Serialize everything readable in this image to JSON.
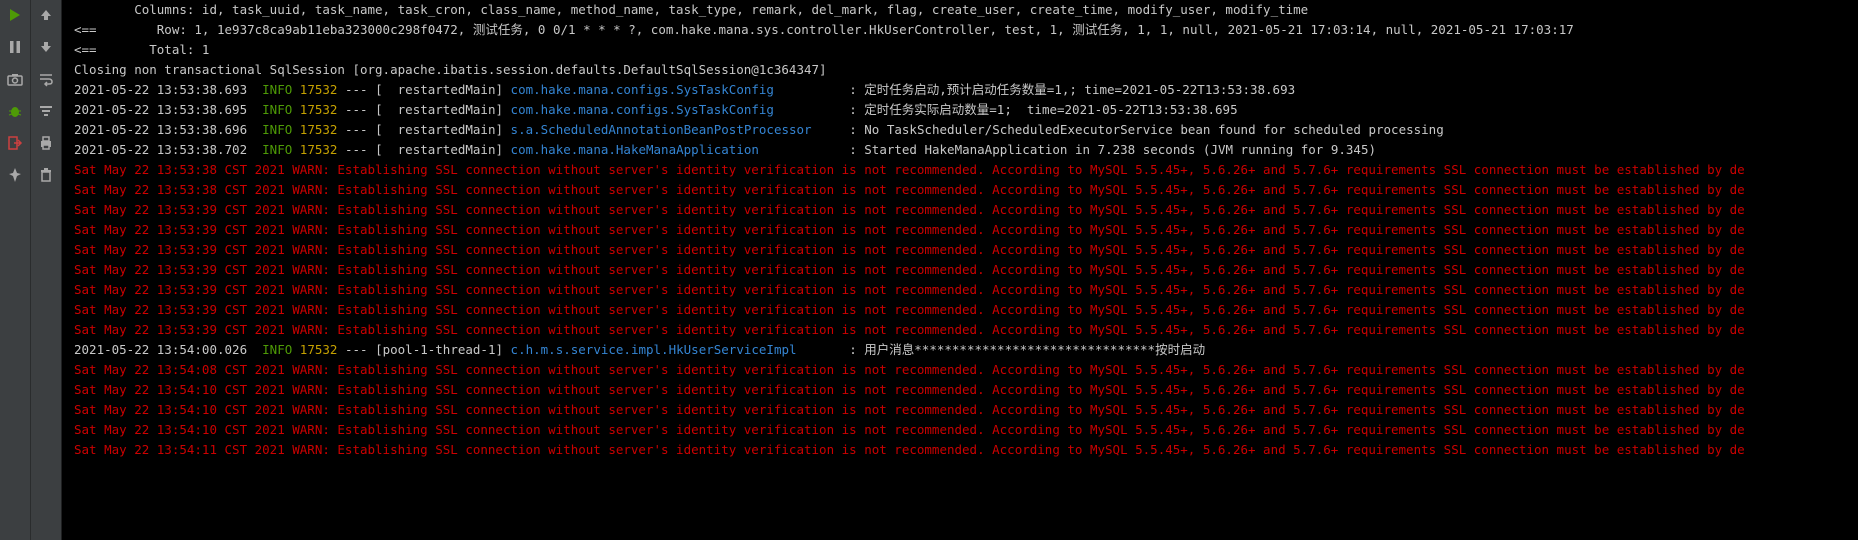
{
  "toolbars": {
    "a": [
      {
        "name": "rerun-icon",
        "glyph": "rerun",
        "interact": true
      },
      {
        "name": "pause-icon",
        "glyph": "pause",
        "interact": true
      },
      {
        "name": "camera-icon",
        "glyph": "camera",
        "interact": true
      },
      {
        "name": "bug-icon",
        "glyph": "bug",
        "interact": true
      },
      {
        "name": "exit-icon",
        "glyph": "exit",
        "interact": true
      },
      {
        "name": "pin-icon",
        "glyph": "pin",
        "interact": true
      }
    ],
    "b": [
      {
        "name": "scroll-up-icon",
        "glyph": "up",
        "interact": true
      },
      {
        "name": "scroll-down-icon",
        "glyph": "down",
        "interact": true
      },
      {
        "name": "wrap-icon",
        "glyph": "wrap",
        "interact": true
      },
      {
        "name": "filter-icon",
        "glyph": "filter",
        "interact": true
      },
      {
        "name": "print-icon",
        "glyph": "print",
        "interact": true
      },
      {
        "name": "trash-icon",
        "glyph": "trash",
        "interact": true
      }
    ]
  },
  "colors": {
    "plain": "#c8c8c8",
    "info_green": "#4e9a06",
    "pid_yellow": "#c4a000",
    "class_blue": "#3484d2",
    "warn_red": "#cc0000",
    "gutter": "#3c3f41"
  },
  "lines": [
    {
      "type": "plain",
      "pre": "        Columns: id, task_uuid, task_name, task_cron, class_name, method_name, task_type, remark, del_mark, flag, create_user, create_time, modify_user, modify_time"
    },
    {
      "type": "plain",
      "pre": "<==        Row: 1, 1e937c8ca9ab11eba323000c298f0472, 测试任务, 0 0/1 * * * ?, com.hake.mana.sys.controller.HkUserController, test, 1, 测试任务, 1, 1, null, 2021-05-21 17:03:14, null, 2021-05-21 17:03:17"
    },
    {
      "type": "plain",
      "pre": "<==       Total: 1"
    },
    {
      "type": "plain",
      "pre": "Closing non transactional SqlSession [org.apache.ibatis.session.defaults.DefaultSqlSession@1c364347]"
    },
    {
      "type": "info",
      "ts": "2021-05-22 13:53:38.693",
      "lvl": "INFO",
      "pid": "17532",
      "thr": "[  restartedMain]",
      "cls": "com.hake.mana.configs.SysTaskConfig         ",
      "msg": ": 定时任务启动,预计启动任务数量=1,; time=2021-05-22T13:53:38.693"
    },
    {
      "type": "info",
      "ts": "2021-05-22 13:53:38.695",
      "lvl": "INFO",
      "pid": "17532",
      "thr": "[  restartedMain]",
      "cls": "com.hake.mana.configs.SysTaskConfig         ",
      "msg": ": 定时任务实际启动数量=1;  time=2021-05-22T13:53:38.695"
    },
    {
      "type": "info",
      "ts": "2021-05-22 13:53:38.696",
      "lvl": "INFO",
      "pid": "17532",
      "thr": "[  restartedMain]",
      "cls": "s.a.ScheduledAnnotationBeanPostProcessor    ",
      "msg": ": No TaskScheduler/ScheduledExecutorService bean found for scheduled processing"
    },
    {
      "type": "info",
      "ts": "2021-05-22 13:53:38.702",
      "lvl": "INFO",
      "pid": "17532",
      "thr": "[  restartedMain]",
      "cls": "com.hake.mana.HakeManaApplication           ",
      "msg": ": Started HakeManaApplication in 7.238 seconds (JVM running for 9.345)"
    },
    {
      "type": "warn",
      "pre": "Sat May 22 13:53:38 CST 2021 WARN: Establishing SSL connection without server's identity verification is not recommended. According to MySQL 5.5.45+, 5.6.26+ and 5.7.6+ requirements SSL connection must be established by de"
    },
    {
      "type": "warn",
      "pre": "Sat May 22 13:53:38 CST 2021 WARN: Establishing SSL connection without server's identity verification is not recommended. According to MySQL 5.5.45+, 5.6.26+ and 5.7.6+ requirements SSL connection must be established by de"
    },
    {
      "type": "warn",
      "pre": "Sat May 22 13:53:39 CST 2021 WARN: Establishing SSL connection without server's identity verification is not recommended. According to MySQL 5.5.45+, 5.6.26+ and 5.7.6+ requirements SSL connection must be established by de"
    },
    {
      "type": "warn",
      "pre": "Sat May 22 13:53:39 CST 2021 WARN: Establishing SSL connection without server's identity verification is not recommended. According to MySQL 5.5.45+, 5.6.26+ and 5.7.6+ requirements SSL connection must be established by de"
    },
    {
      "type": "warn",
      "pre": "Sat May 22 13:53:39 CST 2021 WARN: Establishing SSL connection without server's identity verification is not recommended. According to MySQL 5.5.45+, 5.6.26+ and 5.7.6+ requirements SSL connection must be established by de"
    },
    {
      "type": "warn",
      "pre": "Sat May 22 13:53:39 CST 2021 WARN: Establishing SSL connection without server's identity verification is not recommended. According to MySQL 5.5.45+, 5.6.26+ and 5.7.6+ requirements SSL connection must be established by de"
    },
    {
      "type": "warn",
      "pre": "Sat May 22 13:53:39 CST 2021 WARN: Establishing SSL connection without server's identity verification is not recommended. According to MySQL 5.5.45+, 5.6.26+ and 5.7.6+ requirements SSL connection must be established by de"
    },
    {
      "type": "warn",
      "pre": "Sat May 22 13:53:39 CST 2021 WARN: Establishing SSL connection without server's identity verification is not recommended. According to MySQL 5.5.45+, 5.6.26+ and 5.7.6+ requirements SSL connection must be established by de"
    },
    {
      "type": "warn",
      "pre": "Sat May 22 13:53:39 CST 2021 WARN: Establishing SSL connection without server's identity verification is not recommended. According to MySQL 5.5.45+, 5.6.26+ and 5.7.6+ requirements SSL connection must be established by de"
    },
    {
      "type": "info",
      "ts": "2021-05-22 13:54:00.026",
      "lvl": "INFO",
      "pid": "17532",
      "thr": "[pool-1-thread-1]",
      "cls": "c.h.m.s.service.impl.HkUserServiceImpl      ",
      "msg": ": 用户消息********************************按时启动"
    },
    {
      "type": "warn",
      "pre": "Sat May 22 13:54:08 CST 2021 WARN: Establishing SSL connection without server's identity verification is not recommended. According to MySQL 5.5.45+, 5.6.26+ and 5.7.6+ requirements SSL connection must be established by de"
    },
    {
      "type": "warn",
      "pre": "Sat May 22 13:54:10 CST 2021 WARN: Establishing SSL connection without server's identity verification is not recommended. According to MySQL 5.5.45+, 5.6.26+ and 5.7.6+ requirements SSL connection must be established by de"
    },
    {
      "type": "warn",
      "pre": "Sat May 22 13:54:10 CST 2021 WARN: Establishing SSL connection without server's identity verification is not recommended. According to MySQL 5.5.45+, 5.6.26+ and 5.7.6+ requirements SSL connection must be established by de"
    },
    {
      "type": "warn",
      "pre": "Sat May 22 13:54:10 CST 2021 WARN: Establishing SSL connection without server's identity verification is not recommended. According to MySQL 5.5.45+, 5.6.26+ and 5.7.6+ requirements SSL connection must be established by de"
    },
    {
      "type": "warn",
      "pre": "Sat May 22 13:54:11 CST 2021 WARN: Establishing SSL connection without server's identity verification is not recommended. According to MySQL 5.5.45+, 5.6.26+ and 5.7.6+ requirements SSL connection must be established by de"
    }
  ]
}
